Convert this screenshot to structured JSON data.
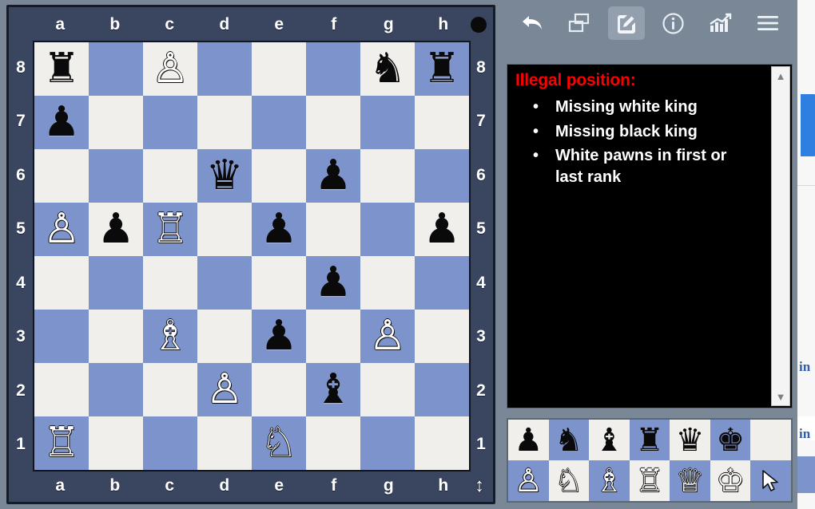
{
  "app": {
    "type": "chess-position-editor",
    "background_color": "#7a8797"
  },
  "board": {
    "files": [
      "a",
      "b",
      "c",
      "d",
      "e",
      "f",
      "g",
      "h"
    ],
    "ranks": [
      "8",
      "7",
      "6",
      "5",
      "4",
      "3",
      "2",
      "1"
    ],
    "light_square_color": "#f0efeb",
    "dark_square_color": "#7d93cc",
    "frame_color": "#3a4560",
    "side_to_move": "black",
    "side_to_move_indicator": "black-dot",
    "resize_handle_icon": "vertical-resize-arrows",
    "squares": [
      [
        {
          "p": "r",
          "c": "b"
        },
        {
          "p": "",
          "c": ""
        },
        {
          "p": "p",
          "c": "w"
        },
        {
          "p": "",
          "c": ""
        },
        {
          "p": "",
          "c": ""
        },
        {
          "p": "",
          "c": ""
        },
        {
          "p": "n",
          "c": "b"
        },
        {
          "p": "r",
          "c": "b"
        }
      ],
      [
        {
          "p": "p",
          "c": "b"
        },
        {
          "p": "",
          "c": ""
        },
        {
          "p": "",
          "c": ""
        },
        {
          "p": "",
          "c": ""
        },
        {
          "p": "",
          "c": ""
        },
        {
          "p": "",
          "c": ""
        },
        {
          "p": "",
          "c": ""
        },
        {
          "p": "",
          "c": ""
        }
      ],
      [
        {
          "p": "",
          "c": ""
        },
        {
          "p": "",
          "c": ""
        },
        {
          "p": "",
          "c": ""
        },
        {
          "p": "q",
          "c": "b"
        },
        {
          "p": "",
          "c": ""
        },
        {
          "p": "p",
          "c": "b"
        },
        {
          "p": "",
          "c": ""
        },
        {
          "p": "",
          "c": ""
        }
      ],
      [
        {
          "p": "p",
          "c": "w"
        },
        {
          "p": "p",
          "c": "b"
        },
        {
          "p": "r",
          "c": "w"
        },
        {
          "p": "",
          "c": ""
        },
        {
          "p": "p",
          "c": "b"
        },
        {
          "p": "",
          "c": ""
        },
        {
          "p": "",
          "c": ""
        },
        {
          "p": "p",
          "c": "b"
        }
      ],
      [
        {
          "p": "",
          "c": ""
        },
        {
          "p": "",
          "c": ""
        },
        {
          "p": "",
          "c": ""
        },
        {
          "p": "",
          "c": ""
        },
        {
          "p": "",
          "c": ""
        },
        {
          "p": "p",
          "c": "b"
        },
        {
          "p": "",
          "c": ""
        },
        {
          "p": "",
          "c": ""
        }
      ],
      [
        {
          "p": "",
          "c": ""
        },
        {
          "p": "",
          "c": ""
        },
        {
          "p": "b",
          "c": "w"
        },
        {
          "p": "",
          "c": ""
        },
        {
          "p": "p",
          "c": "b"
        },
        {
          "p": "",
          "c": ""
        },
        {
          "p": "p",
          "c": "w"
        },
        {
          "p": "",
          "c": ""
        }
      ],
      [
        {
          "p": "",
          "c": ""
        },
        {
          "p": "",
          "c": ""
        },
        {
          "p": "",
          "c": ""
        },
        {
          "p": "p",
          "c": "w"
        },
        {
          "p": "",
          "c": ""
        },
        {
          "p": "b",
          "c": "b"
        },
        {
          "p": "",
          "c": ""
        },
        {
          "p": "",
          "c": ""
        }
      ],
      [
        {
          "p": "r",
          "c": "w"
        },
        {
          "p": "",
          "c": ""
        },
        {
          "p": "",
          "c": ""
        },
        {
          "p": "",
          "c": ""
        },
        {
          "p": "n",
          "c": "w"
        },
        {
          "p": "",
          "c": ""
        },
        {
          "p": "",
          "c": ""
        },
        {
          "p": "",
          "c": ""
        }
      ]
    ]
  },
  "toolbar": {
    "buttons": [
      {
        "name": "back-arrow-icon",
        "label": "Back",
        "active": false
      },
      {
        "name": "copy-windows-icon",
        "label": "Copy position",
        "active": false
      },
      {
        "name": "edit-pencil-icon",
        "label": "Edit position",
        "active": true
      },
      {
        "name": "info-circle-icon",
        "label": "Information",
        "active": false
      },
      {
        "name": "analysis-chart-icon",
        "label": "Analysis",
        "active": false
      },
      {
        "name": "hamburger-menu-icon",
        "label": "Menu",
        "active": false
      }
    ]
  },
  "message_panel": {
    "title": "Illegal position:",
    "title_color": "#ff0000",
    "text_color": "#ffffff",
    "background_color": "#000000",
    "items": [
      "Missing white king",
      "Missing black king",
      "White pawns in first or last rank"
    ],
    "scrollbar": {
      "up_arrow": "▲",
      "down_arrow": "▼"
    }
  },
  "palette": {
    "rows": [
      [
        {
          "name": "palette-black-pawn",
          "piece": "p",
          "color": "b",
          "square": "light"
        },
        {
          "name": "palette-black-knight",
          "piece": "n",
          "color": "b",
          "square": "dark"
        },
        {
          "name": "palette-black-bishop",
          "piece": "b",
          "color": "b",
          "square": "light"
        },
        {
          "name": "palette-black-rook",
          "piece": "r",
          "color": "b",
          "square": "dark"
        },
        {
          "name": "palette-black-queen",
          "piece": "q",
          "color": "b",
          "square": "light"
        },
        {
          "name": "palette-black-king",
          "piece": "k",
          "color": "b",
          "square": "dark"
        },
        {
          "name": "palette-eraser",
          "piece": "",
          "color": "",
          "square": "light"
        }
      ],
      [
        {
          "name": "palette-white-pawn",
          "piece": "p",
          "color": "w",
          "square": "dark"
        },
        {
          "name": "palette-white-knight",
          "piece": "n",
          "color": "w",
          "square": "light"
        },
        {
          "name": "palette-white-bishop",
          "piece": "b",
          "color": "w",
          "square": "dark"
        },
        {
          "name": "palette-white-rook",
          "piece": "r",
          "color": "w",
          "square": "light"
        },
        {
          "name": "palette-white-queen",
          "piece": "q",
          "color": "w",
          "square": "dark"
        },
        {
          "name": "palette-white-king",
          "piece": "k",
          "color": "w",
          "square": "light"
        },
        {
          "name": "palette-cursor-tool",
          "piece": "cursor",
          "color": "",
          "square": "dark"
        }
      ]
    ]
  },
  "edge_strip": {
    "partial_text_1": "in",
    "partial_text_2": "in",
    "accent_color": "#2f7fe0"
  }
}
